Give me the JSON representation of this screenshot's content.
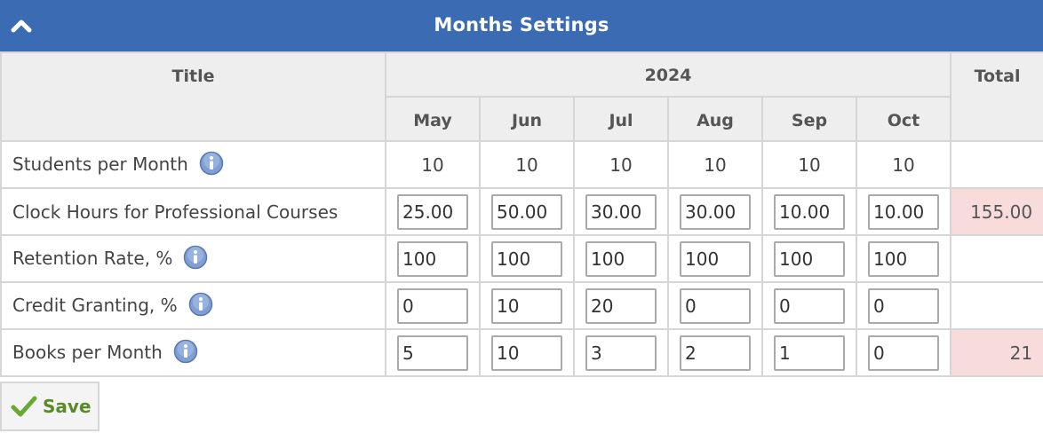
{
  "header": {
    "title": "Months Settings",
    "collapse_icon": "chevron-up-icon"
  },
  "table": {
    "col_title": "Title",
    "year": "2024",
    "col_total": "Total",
    "months": [
      "May",
      "Jun",
      "Jul",
      "Aug",
      "Sep",
      "Oct"
    ],
    "rows": [
      {
        "label": "Students per Month",
        "info": true,
        "editable": false,
        "values": [
          "10",
          "10",
          "10",
          "10",
          "10",
          "10"
        ],
        "total": ""
      },
      {
        "label": "Clock Hours for Professional Courses",
        "info": false,
        "editable": true,
        "values": [
          "25.00",
          "50.00",
          "30.00",
          "30.00",
          "10.00",
          "10.00"
        ],
        "total": "155.00"
      },
      {
        "label": "Retention Rate, %",
        "info": true,
        "editable": true,
        "values": [
          "100",
          "100",
          "100",
          "100",
          "100",
          "100"
        ],
        "total": ""
      },
      {
        "label": "Credit Granting, %",
        "info": true,
        "editable": true,
        "values": [
          "0",
          "10",
          "20",
          "0",
          "0",
          "0"
        ],
        "total": ""
      },
      {
        "label": "Books per Month",
        "info": true,
        "editable": true,
        "values": [
          "5",
          "10",
          "3",
          "2",
          "1",
          "0"
        ],
        "total": "21"
      }
    ],
    "info_icon": "info-icon"
  },
  "footer": {
    "save_label": "Save",
    "save_icon": "checkmark-icon"
  },
  "colors": {
    "header_bg": "#3b6cb3",
    "highlight_total": "#f8dcdc",
    "save_text": "#5a8a25"
  }
}
